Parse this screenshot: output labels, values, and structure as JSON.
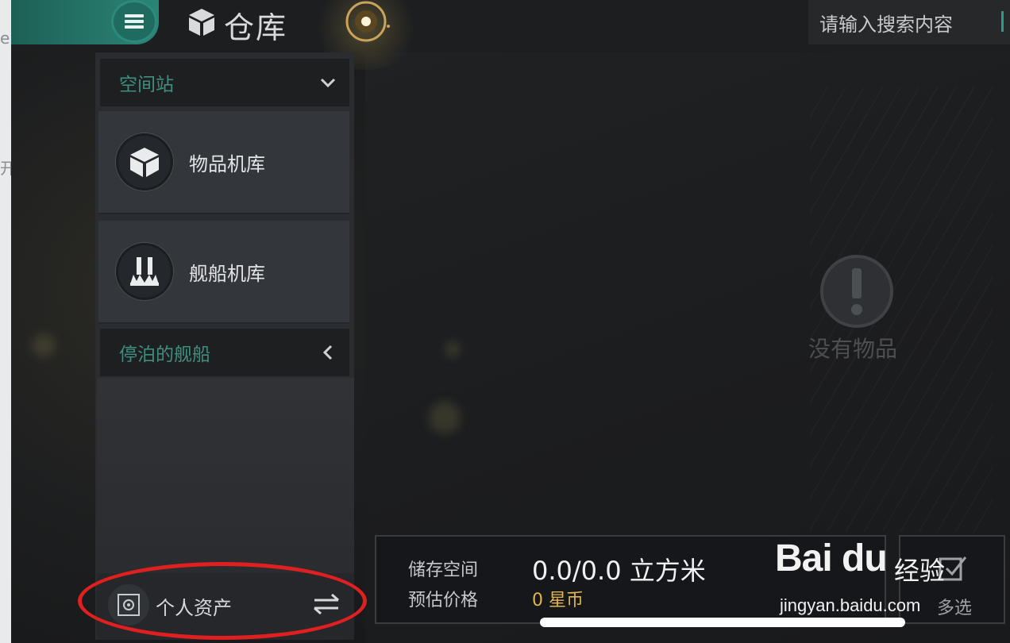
{
  "edge": {
    "glyph_top": "e",
    "glyph_mid": "开"
  },
  "header": {
    "title": "仓库",
    "search_placeholder": "请输入搜索内容"
  },
  "sidebar": {
    "section_station": "空间站",
    "items": [
      {
        "label": "物品机库",
        "icon": "cube-icon"
      },
      {
        "label": "舰船机库",
        "icon": "ship-icon"
      }
    ],
    "section_docked": "停泊的舰船",
    "personal_assets": "个人资产"
  },
  "main": {
    "empty_text": "没有物品"
  },
  "storage": {
    "space_label": "储存空间",
    "space_value": "0.0/0.0 立方米",
    "price_label": "预估价格",
    "price_value": "0 星币",
    "multi_select": "多选"
  },
  "watermark": {
    "logo": "Bai du",
    "brand": "经验",
    "url": "jingyan.baidu.com"
  },
  "colors": {
    "accent": "#2a8576",
    "price": "#e3b54a",
    "annotation": "#e02020"
  }
}
